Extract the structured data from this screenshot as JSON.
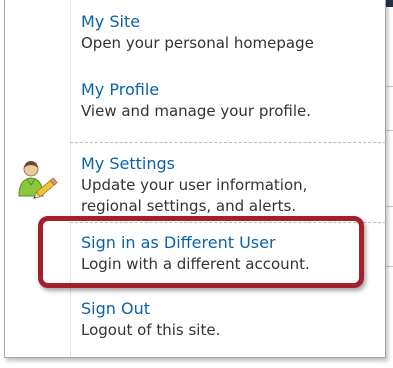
{
  "menu": {
    "items": [
      {
        "title": "My Site",
        "desc": "Open your personal homepage"
      },
      {
        "title": "My Profile",
        "desc": "View and manage your profile."
      },
      {
        "title": "My Settings",
        "desc": "Update your user information,\nregional settings, and alerts."
      },
      {
        "title": "Sign in as Different User",
        "desc": "Login with a different account."
      },
      {
        "title": "Sign Out",
        "desc": "Logout of this site."
      }
    ]
  },
  "icons": {
    "user_settings": "user-settings-icon"
  },
  "colors": {
    "link_blue": "#0b62ab",
    "text_gray": "#333333",
    "highlight_red": "#a2202c",
    "header_navy": "#1f3349"
  }
}
